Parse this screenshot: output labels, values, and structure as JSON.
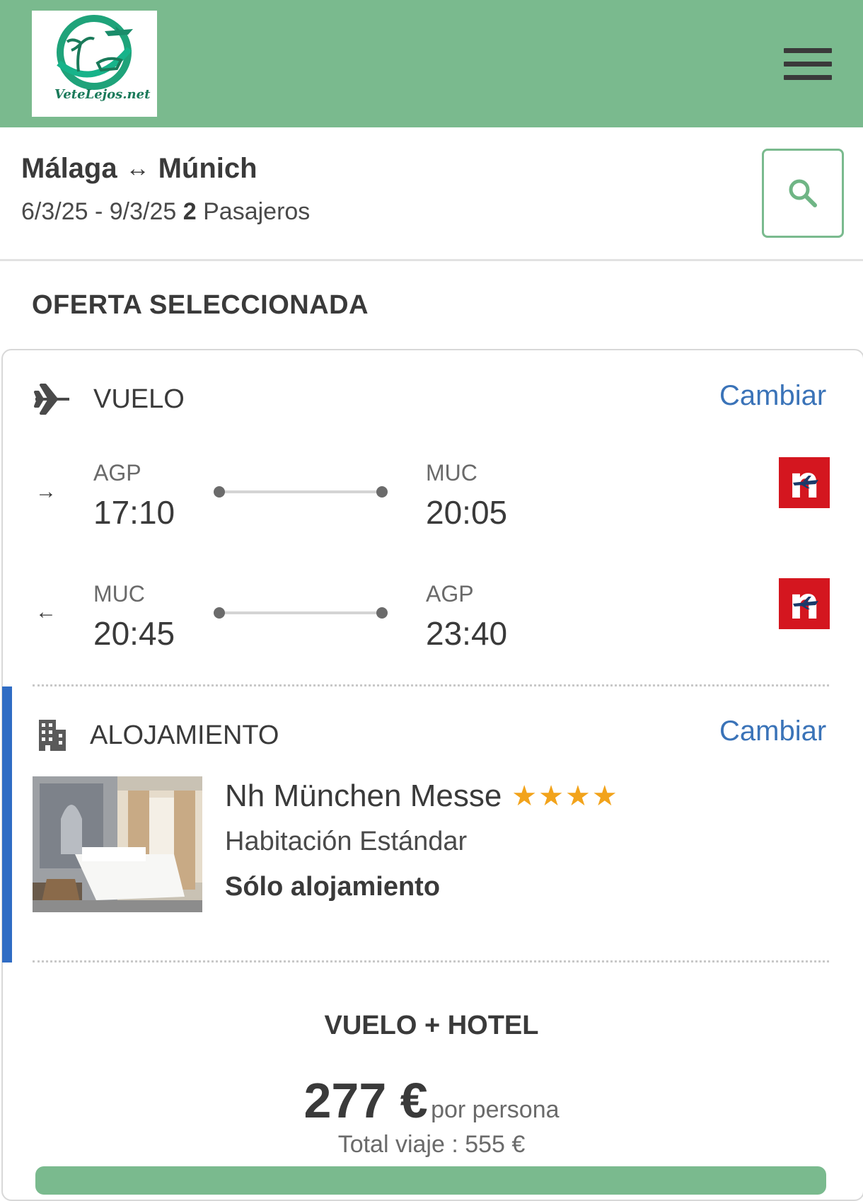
{
  "brand": {
    "logo_text": "VeteLejos.net",
    "primary_color": "#7aba8e",
    "link_color": "#3a73b8",
    "accent_bar_color": "#2f6cc4",
    "star_color": "#f2a31b"
  },
  "header": {
    "menu_icon": "hamburger-menu-icon"
  },
  "search": {
    "origin": "Málaga",
    "route_arrow": "↔",
    "destination": "Múnich",
    "dates": "6/3/25 - 9/3/25",
    "passengers_count": "2",
    "passengers_label": "Pasajeros",
    "search_icon": "search-icon"
  },
  "section_title": "OFERTA SELECCIONADA",
  "flight": {
    "label": "VUELO",
    "change_label": "Cambiar",
    "legs": [
      {
        "direction": "→",
        "from_code": "AGP",
        "from_time": "17:10",
        "to_code": "MUC",
        "to_time": "20:05",
        "airline_letter": "n"
      },
      {
        "direction": "←",
        "from_code": "MUC",
        "from_time": "20:45",
        "to_code": "AGP",
        "to_time": "23:40",
        "airline_letter": "n"
      }
    ]
  },
  "accommodation": {
    "label": "ALOJAMIENTO",
    "change_label": "Cambiar",
    "hotel_name": "Nh München Messe",
    "stars": "★★★★",
    "stars_count": 4,
    "room": "Habitación Estándar",
    "board": "Sólo alojamiento"
  },
  "package": {
    "title": "VUELO + HOTEL",
    "price": "277 €",
    "per_person": "por persona",
    "total": "Total viaje : 555 €"
  }
}
